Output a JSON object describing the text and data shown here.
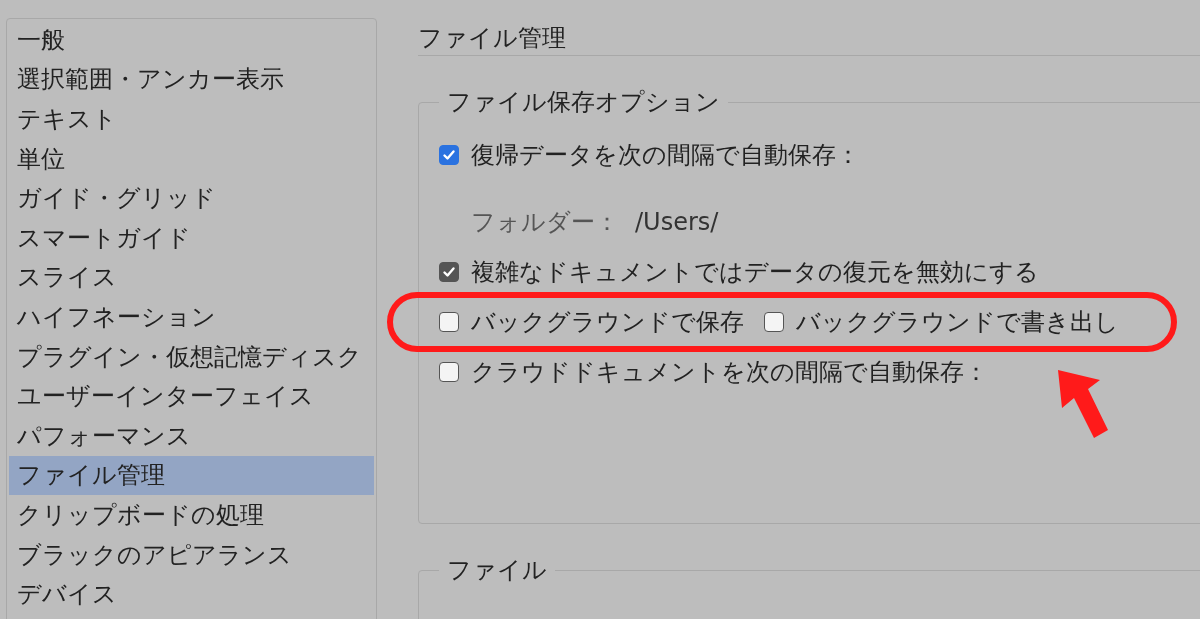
{
  "sidebar": {
    "items": [
      {
        "label": "一般",
        "selected": false
      },
      {
        "label": "選択範囲・アンカー表示",
        "selected": false
      },
      {
        "label": "テキスト",
        "selected": false
      },
      {
        "label": "単位",
        "selected": false
      },
      {
        "label": "ガイド・グリッド",
        "selected": false
      },
      {
        "label": "スマートガイド",
        "selected": false
      },
      {
        "label": "スライス",
        "selected": false
      },
      {
        "label": "ハイフネーション",
        "selected": false
      },
      {
        "label": "プラグイン・仮想記憶ディスク",
        "selected": false
      },
      {
        "label": "ユーザーインターフェイス",
        "selected": false
      },
      {
        "label": "パフォーマンス",
        "selected": false
      },
      {
        "label": "ファイル管理",
        "selected": true
      },
      {
        "label": "クリップボードの処理",
        "selected": false
      },
      {
        "label": "ブラックのアピアランス",
        "selected": false
      },
      {
        "label": "デバイス",
        "selected": false
      }
    ]
  },
  "page": {
    "title": "ファイル管理"
  },
  "groups": [
    {
      "title": "ファイル保存オプション",
      "rows": [
        {
          "kind": "checkbox",
          "label": "復帰データを次の間隔で自動保存：",
          "checked": true,
          "disabled": false
        },
        {
          "kind": "path",
          "label": "フォルダー：",
          "value": "/Users/"
        },
        {
          "kind": "checkbox",
          "label": "複雑なドキュメントではデータの復元を無効にする",
          "checked": true,
          "disabled": true
        },
        {
          "kind": "pair",
          "highlighted": true,
          "items": [
            {
              "label": "バックグラウンドで保存",
              "checked": false
            },
            {
              "label": "バックグラウンドで書き出し",
              "checked": false
            }
          ]
        },
        {
          "kind": "checkbox",
          "label": "クラウドドキュメントを次の間隔で自動保存：",
          "checked": false,
          "disabled": false
        }
      ]
    },
    {
      "title": "ファイル"
    }
  ]
}
